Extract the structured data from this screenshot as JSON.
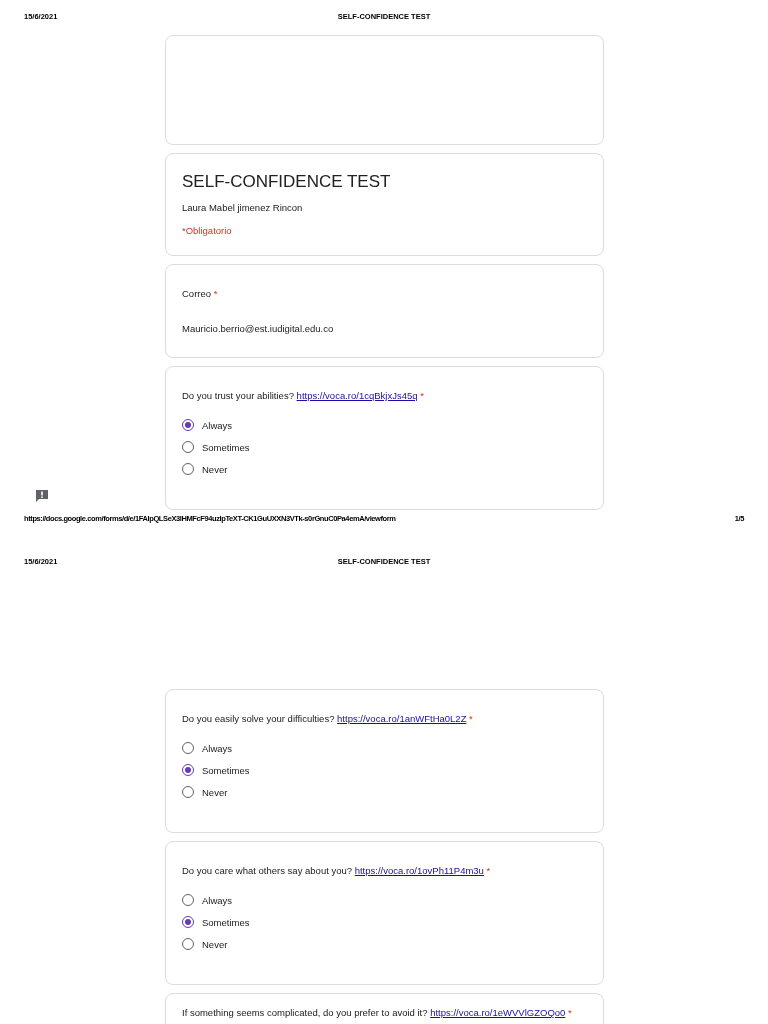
{
  "pages": [
    {
      "header": {
        "date": "15/6/2021",
        "title": "SELF-CONFIDENCE TEST"
      },
      "banner": {
        "kind": "empty"
      },
      "form_header": {
        "title": "SELF-CONFIDENCE TEST",
        "subtitle": "Laura Mabel jimenez Rincon",
        "required_note": "*Obligatorio"
      },
      "questions": [
        {
          "kind": "text",
          "label": "Correo",
          "required_mark": "*",
          "answer": "Mauricio.berrio@est.iudigital.edu.co"
        },
        {
          "kind": "choice",
          "label": "Do you trust your abilities?",
          "link": "https://voca.ro/1cqBkjxJs45q",
          "required_mark": "*",
          "options": [
            {
              "label": "Always",
              "selected": true
            },
            {
              "label": "Sometimes",
              "selected": false
            },
            {
              "label": "Never",
              "selected": false
            }
          ]
        }
      ],
      "footer": {
        "url": "https://docs.google.com/forms/d/e/1FAIpQLSeX3IHMFcF94uzIpTeXT-CK1GuUXXN3VTk-s0rGnuC0Pa4emA/viewform",
        "page_number": "1/5"
      }
    },
    {
      "header": {
        "date": "15/6/2021",
        "title": "SELF-CONFIDENCE TEST"
      },
      "questions": [
        {
          "kind": "choice",
          "label": "Do you easily solve your difficulties?",
          "link": "https://voca.ro/1anWFtHa0L2Z",
          "required_mark": "*",
          "options": [
            {
              "label": "Always",
              "selected": false
            },
            {
              "label": "Sometimes",
              "selected": true
            },
            {
              "label": "Never",
              "selected": false
            }
          ]
        },
        {
          "kind": "choice",
          "label": "Do you care what others say about you?",
          "link": "https://voca.ro/1ovPh11P4m3u",
          "required_mark": "*",
          "options": [
            {
              "label": "Always",
              "selected": false
            },
            {
              "label": "Sometimes",
              "selected": true
            },
            {
              "label": "Never",
              "selected": false
            }
          ]
        },
        {
          "kind": "choice",
          "label": "If something seems complicated, do you prefer to avoid it?",
          "link": "https://voca.ro/1eWVVlGZOQo0",
          "required_mark": "*"
        }
      ]
    }
  ]
}
